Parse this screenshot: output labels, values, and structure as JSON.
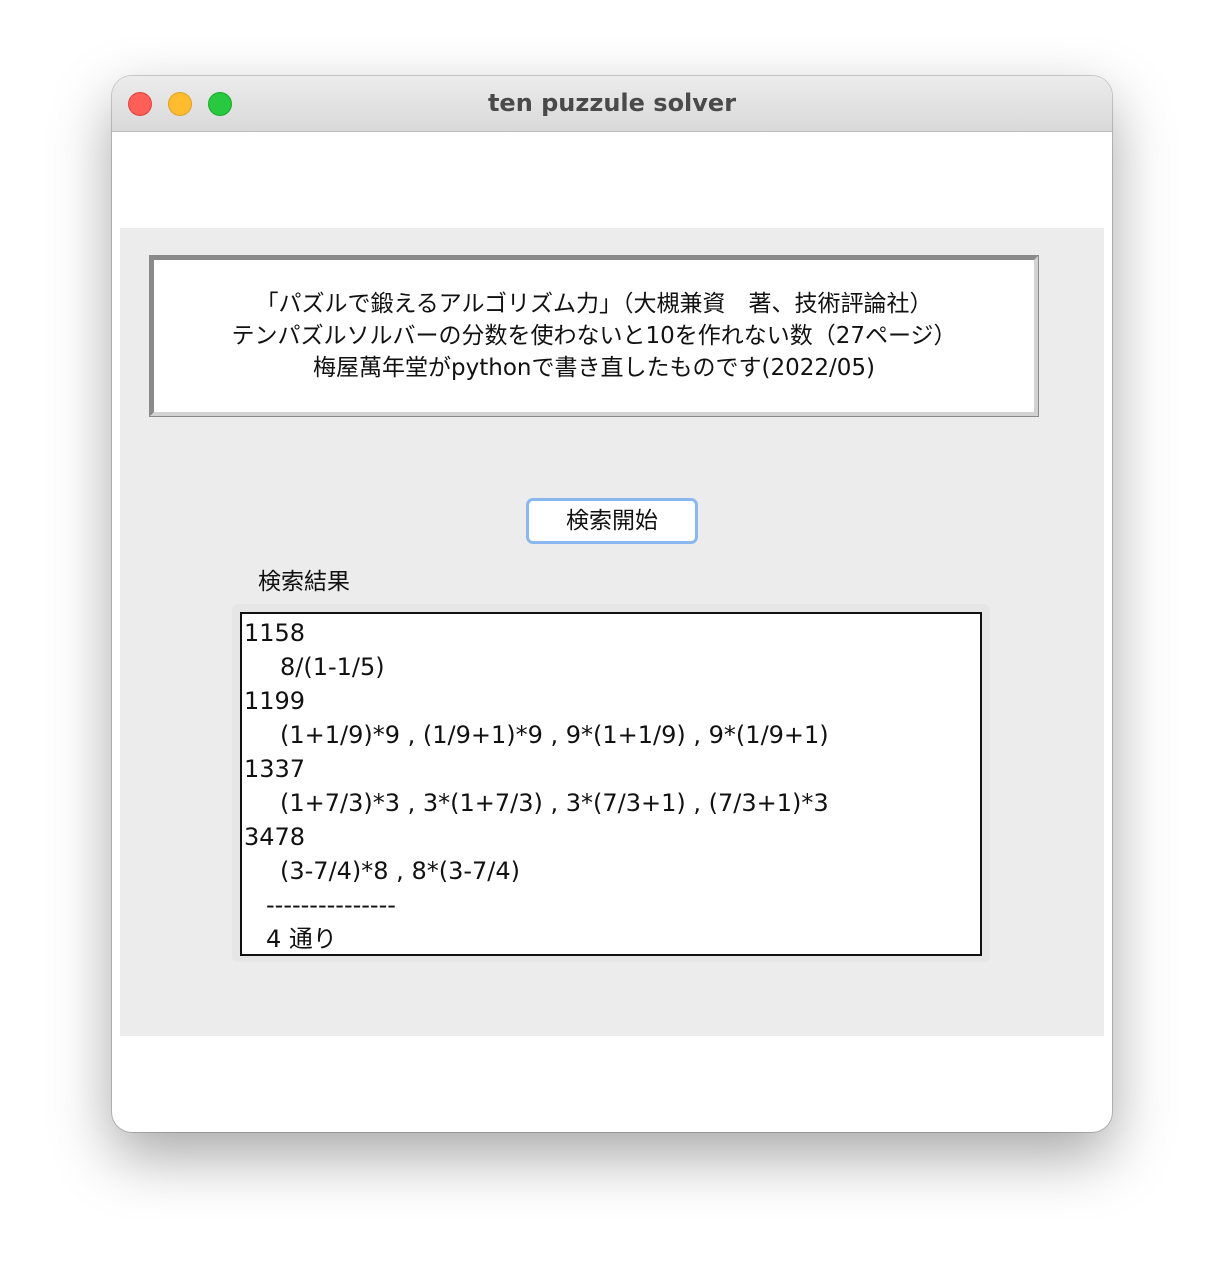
{
  "window": {
    "title": "ten puzzule solver"
  },
  "info": {
    "lines": [
      "「パズルで鍛えるアルゴリズム力」（大槻兼資　著、技術評論社）",
      "テンパズルソルバーの分数を使わないと10を作れない数（27ページ）",
      "梅屋萬年堂がpythonで書き直したものです(2022/05)"
    ]
  },
  "search_button": {
    "label": "検索開始"
  },
  "results": {
    "label": "検索結果",
    "entries": [
      {
        "number": "1158",
        "expressions": "8/(1-1/5)"
      },
      {
        "number": "1199",
        "expressions": "(1+1/9)*9 , (1/9+1)*9 , 9*(1+1/9) , 9*(1/9+1)"
      },
      {
        "number": "1337",
        "expressions": "(1+7/3)*3 , 3*(1+7/3) , 3*(7/3+1) , (7/3+1)*3"
      },
      {
        "number": "3478",
        "expressions": "(3-7/4)*8 , 8*(3-7/4)"
      }
    ],
    "separator": "---------------",
    "count": "4 通り"
  },
  "colors": {
    "close": "#ff5f57",
    "minimize": "#febc2e",
    "maximize": "#28c840",
    "button_focus": "#8ab8ee",
    "panel": "#ececec"
  }
}
